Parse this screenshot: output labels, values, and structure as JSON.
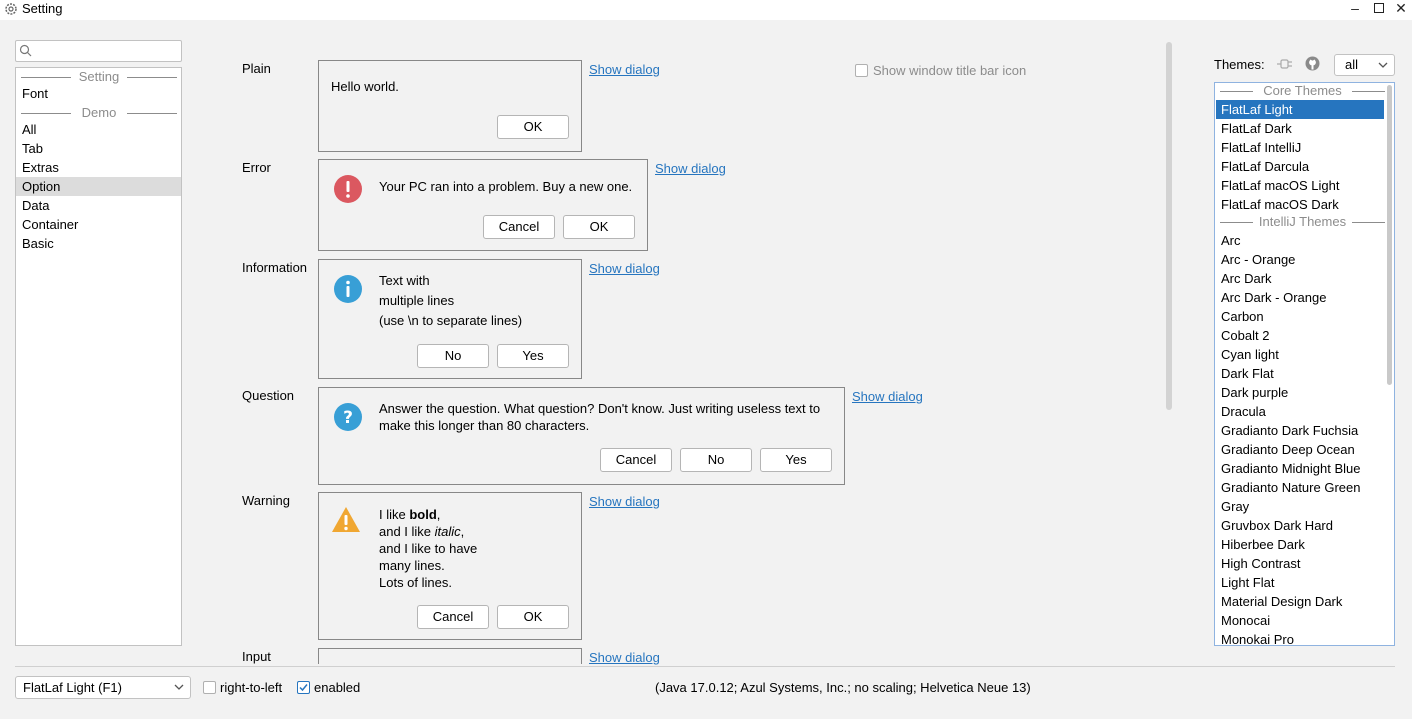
{
  "window": {
    "title": "Setting",
    "icon": "gear-icon",
    "controls": [
      "minimize",
      "maximize",
      "close"
    ]
  },
  "sidebar": {
    "search": {
      "value": "",
      "placeholder": ""
    },
    "sections": [
      {
        "header": "Setting",
        "items": [
          "Font"
        ]
      },
      {
        "header": "Demo",
        "items": [
          "All",
          "Tab",
          "Extras",
          "Option",
          "Data",
          "Container",
          "Basic"
        ]
      }
    ],
    "selected": "Option"
  },
  "main": {
    "show_dialog_label": "Show dialog",
    "show_titlebar_icon": {
      "label": "Show window title bar icon",
      "checked": false
    },
    "rows": [
      {
        "label": "Plain",
        "icon": "none",
        "message": [
          "Hello world."
        ],
        "buttons": [
          "OK"
        ]
      },
      {
        "label": "Error",
        "icon": "error-icon",
        "message": [
          "Your PC ran into a problem. Buy a new one."
        ],
        "buttons": [
          "Cancel",
          "OK"
        ]
      },
      {
        "label": "Information",
        "icon": "info-icon",
        "message": [
          "Text with",
          "multiple lines",
          "(use \\n to separate lines)"
        ],
        "buttons": [
          "No",
          "Yes"
        ]
      },
      {
        "label": "Question",
        "icon": "question-icon",
        "message": [
          "Answer the question. What question? Don't know. Just writing useless text to",
          "make this longer than 80 characters."
        ],
        "buttons": [
          "Cancel",
          "No",
          "Yes"
        ]
      },
      {
        "label": "Warning",
        "icon": "warning-icon",
        "message_parts": {
          "l1a": "I like ",
          "l1b": "bold",
          "l1c": ",",
          "l2a": "and I like ",
          "l2b": "italic",
          "l2c": ",",
          "l3": "and I like to have",
          "l4": "many lines.",
          "l5": "Lots of lines."
        },
        "buttons": [
          "Cancel",
          "OK"
        ]
      },
      {
        "label": "Input",
        "icon": "none",
        "message": [],
        "buttons": []
      }
    ]
  },
  "themes": {
    "label": "Themes:",
    "filter": "all",
    "core_header": "Core Themes",
    "core": [
      "FlatLaf Light",
      "FlatLaf Dark",
      "FlatLaf IntelliJ",
      "FlatLaf Darcula",
      "FlatLaf macOS Light",
      "FlatLaf macOS Dark"
    ],
    "intellij_header": "IntelliJ Themes",
    "intellij": [
      "Arc",
      "Arc - Orange",
      "Arc Dark",
      "Arc Dark - Orange",
      "Carbon",
      "Cobalt 2",
      "Cyan light",
      "Dark Flat",
      "Dark purple",
      "Dracula",
      "Gradianto Dark Fuchsia",
      "Gradianto Deep Ocean",
      "Gradianto Midnight Blue",
      "Gradianto Nature Green",
      "Gray",
      "Gruvbox Dark Hard",
      "Hiberbee Dark",
      "High Contrast",
      "Light Flat",
      "Material Design Dark",
      "Monocai",
      "Monokai Pro"
    ],
    "selected": "FlatLaf Light"
  },
  "bottom": {
    "laf": "FlatLaf Light (F1)",
    "rtl": {
      "label": "right-to-left",
      "checked": false
    },
    "enabled": {
      "label": "enabled",
      "checked": true
    },
    "status": "(Java 17.0.12; Azul Systems, Inc.; no scaling; Helvetica Neue 13)"
  },
  "colors": {
    "accent": "#2675bf",
    "error": "#db5860",
    "info": "#389fd6",
    "warning": "#f0a732"
  }
}
